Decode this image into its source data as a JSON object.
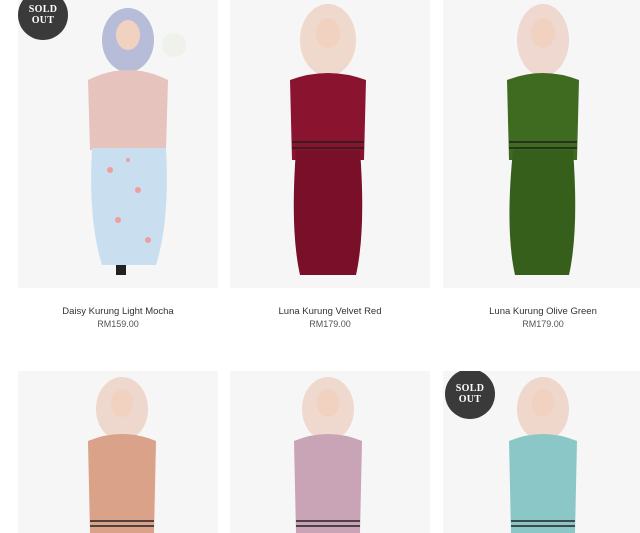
{
  "products": [
    {
      "name": "Daisy Kurung Light Mocha",
      "price": "RM159.00",
      "badge": "SOLD OUT",
      "top_color": "#e7c3bd",
      "bottom_color": "#c9dff0",
      "scarf_color": "#b7bcd9"
    },
    {
      "name": "Luna Kurung Velvet Red",
      "price": "RM179.00",
      "badge": "",
      "top_color": "#8a1330",
      "bottom_color": "#8a1330",
      "scarf_color": "#efd8cc"
    },
    {
      "name": "Luna Kurung Olive Green",
      "price": "RM179.00",
      "badge": "",
      "top_color": "#3f6b20",
      "bottom_color": "#3f6b20",
      "scarf_color": "#eed8cf"
    },
    {
      "name": "",
      "price": "",
      "badge": "",
      "top_color": "#d9a289",
      "bottom_color": "#d9a289",
      "scarf_color": "#eed7cd"
    },
    {
      "name": "",
      "price": "",
      "badge": "",
      "top_color": "#c9a4b6",
      "bottom_color": "#c9a4b6",
      "scarf_color": "#efd8cd"
    },
    {
      "name": "",
      "price": "",
      "badge": "SOLD OUT",
      "top_color": "#8cc7c8",
      "bottom_color": "#8cc7c8",
      "scarf_color": "#efd7cb"
    }
  ]
}
